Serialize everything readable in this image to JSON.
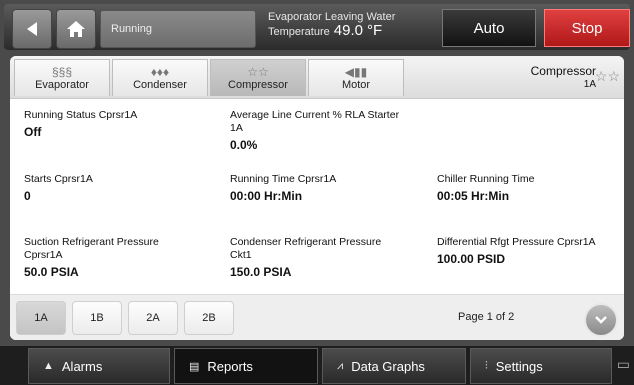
{
  "header": {
    "status": "Running",
    "lwt_label_line1": "Evaporator Leaving Water",
    "lwt_label_line2": "Temperature",
    "lwt_value": "49.0",
    "lwt_unit": "°F",
    "auto_label": "Auto",
    "stop_label": "Stop",
    "colors": {
      "stop": "#c42020",
      "auto": "#1a1a1a"
    }
  },
  "tabs": [
    {
      "label": "Evaporator",
      "icon": "evaporator-icon"
    },
    {
      "label": "Condenser",
      "icon": "condenser-icon"
    },
    {
      "label": "Compressor",
      "icon": "compressor-icon"
    },
    {
      "label": "Motor",
      "icon": "motor-icon"
    }
  ],
  "component": {
    "title": "Compressor",
    "subtitle": "1A"
  },
  "cells": {
    "running_status": {
      "label": "Running Status Cprsr1A",
      "value": "Off"
    },
    "avg_line_current": {
      "label": "Average Line Current % RLA Starter 1A",
      "value": "0.0%"
    },
    "starts": {
      "label": "Starts Cprsr1A",
      "value": "0"
    },
    "running_time": {
      "label": "Running Time Cprsr1A",
      "value": "00:00 Hr:Min"
    },
    "chiller_running_time": {
      "label": "Chiller Running Time",
      "value": "00:05 Hr:Min"
    },
    "suction_pressure": {
      "label": "Suction Refrigerant Pressure Cprsr1A",
      "value": "50.0 PSIA"
    },
    "condenser_pressure": {
      "label": "Condenser Refrigerant Pressure Ckt1",
      "value": "150.0 PSIA"
    },
    "diff_pressure": {
      "label": "Differential Rfgt Pressure Cprsr1A",
      "value": "100.00 PSID"
    }
  },
  "units": [
    "1A",
    "1B",
    "2A",
    "2B"
  ],
  "page": "Page 1 of 2",
  "bottom_nav": [
    {
      "label": "Alarms",
      "icon": "bell-icon"
    },
    {
      "label": "Reports",
      "icon": "report-icon"
    },
    {
      "label": "Data Graphs",
      "icon": "graph-icon"
    },
    {
      "label": "Settings",
      "icon": "settings-icon"
    }
  ]
}
